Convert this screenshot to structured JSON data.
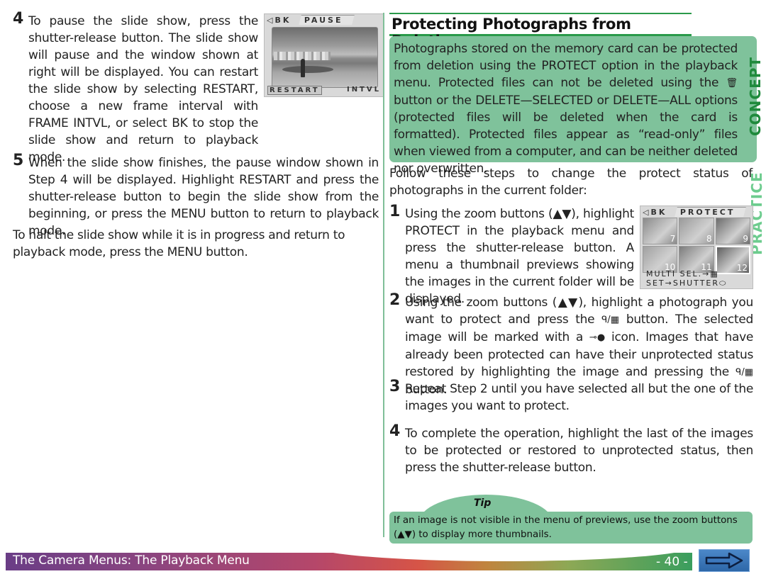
{
  "left_column": {
    "step4": {
      "number": "4",
      "text": "To pause the slide show, press the shutter-release button.  The slide show will pause and the window shown at right will be displayed.  You can restart the slide show by selecting RESTART, choose a new frame interval with FRAME INTVL, or select BK to stop the slide show and return to playback mode."
    },
    "pause_screen": {
      "back_tab": "◁BK",
      "title_tab": "PAUSE",
      "option_selected": "RESTART",
      "option_other": "INTVL"
    },
    "step5": {
      "number": "5",
      "text": "When the slide show finishes, the pause window shown in Step 4 will be displayed.  Highlight RESTART and press the shutter-release button to begin the slide show from the beginning, or press the MENU button to return to playback mode."
    },
    "halt_paragraph": "To halt the slide show while it is in progress and return to playback mode, press the MENU button."
  },
  "right_column": {
    "heading": "Protecting Photographs from Deletion",
    "concept": {
      "text_before_icon": "Photographs stored on the memory card can be protected from deletion using the PROTECT option in the playback menu.  Protected files can not be deleted using the ",
      "trash_icon": "🗑",
      "text_after_icon": " button or the DELETE—SELECTED or DELETE—ALL options (protected files will be deleted when the card is formatted).  Protected files appear as “read-only” files when viewed from a computer, and can be neither deleted nor overwritten.",
      "side_label": "CONCEPT"
    },
    "intro": "Follow these steps to change the protect status of photographs in the current folder:",
    "practice_label": "PRACTICE",
    "step1": {
      "number": "1",
      "text": "Using the zoom buttons (▲▼), highlight PROTECT in the playback menu and press the shutter-release button.  A menu a thumbnail previews showing the images in the current folder will be displayed."
    },
    "protect_screen": {
      "back_tab": "◁BK",
      "title_tab": "PROTECT",
      "thumbnails": [
        {
          "number": "7",
          "tone": "#8a8a8a"
        },
        {
          "number": "8",
          "tone": "#9a9a9a"
        },
        {
          "number": "9",
          "tone": "#6c6c6c"
        },
        {
          "number": "10",
          "tone": "#a0a0a0"
        },
        {
          "number": "11",
          "tone": "#7c7c7c"
        },
        {
          "number": "12",
          "tone": "#5e5e5e"
        }
      ],
      "message_line1": "MULTI SEL.→▦",
      "message_line2": "SET→SHUTTER⬭"
    },
    "step2": {
      "number": "2",
      "text_a": "Using the zoom buttons (▲▼), highlight a photograph you want to protect and press the ",
      "zoom_thumb_icon": "ᑫ/▦",
      "text_b": " button.  The selected image will be marked with a ",
      "key_icon": "⊸●",
      "text_c": " icon.  Images that have already been protected can have their unprotected status restored by highlighting the image and pressing the ",
      "text_d": " button."
    },
    "step3": {
      "number": "3",
      "text": "Repeat Step 2 until you have selected all but the one of the images you want to protect."
    },
    "step4": {
      "number": "4",
      "text": "To complete the operation, highlight the last of the images to be protected or restored to unprotected status, then press the shutter-release button."
    },
    "tip": {
      "title": "Tip",
      "text": "If an image is not visible in the menu of previews, use the zoom buttons (▲▼) to display more thumbnails."
    }
  },
  "footer": {
    "section_title": "The Camera Menus: The Playback Menu",
    "page_number": "- 40 -",
    "next_arrow": "⇨"
  },
  "colors": {
    "accent_green": "#2a9a4a",
    "box_green": "#7fc29b",
    "concept_label": "#1f8a3c",
    "practice_label": "#6dcc8e"
  }
}
